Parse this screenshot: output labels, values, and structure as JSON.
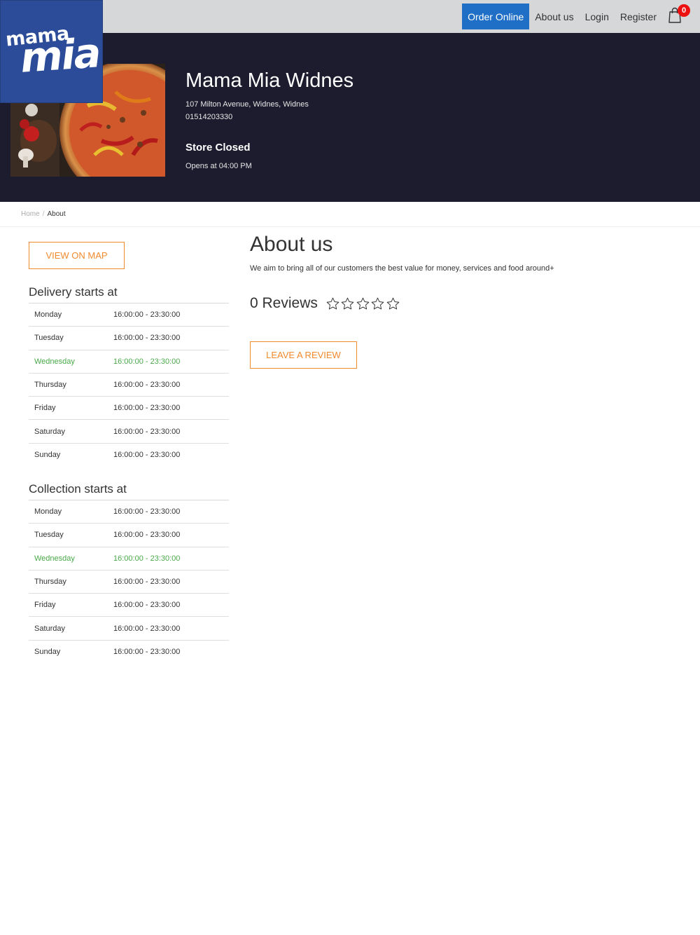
{
  "nav": {
    "order_online": "Order Online",
    "about": "About us",
    "login": "Login",
    "register": "Register",
    "cart_count": "0"
  },
  "logo": {
    "line1": "mama",
    "line2": "mia"
  },
  "store": {
    "name": "Mama Mia Widnes",
    "address": "107 Milton Avenue, Widnes, Widnes",
    "phone": "01514203330",
    "status": "Store Closed",
    "opens": "Opens at 04:00 PM"
  },
  "breadcrumb": {
    "home": "Home",
    "separator": "/",
    "current": "About"
  },
  "map_button": "VIEW ON MAP",
  "delivery": {
    "title": "Delivery starts at",
    "rows": [
      {
        "day": "Monday",
        "time": "16:00:00 - 23:30:00"
      },
      {
        "day": "Tuesday",
        "time": "16:00:00 - 23:30:00"
      },
      {
        "day": "Wednesday",
        "time": "16:00:00 - 23:30:00"
      },
      {
        "day": "Thursday",
        "time": "16:00:00 - 23:30:00"
      },
      {
        "day": "Friday",
        "time": "16:00:00 - 23:30:00"
      },
      {
        "day": "Saturday",
        "time": "16:00:00 - 23:30:00"
      },
      {
        "day": "Sunday",
        "time": "16:00:00 - 23:30:00"
      }
    ]
  },
  "collection": {
    "title": "Collection starts at",
    "rows": [
      {
        "day": "Monday",
        "time": "16:00:00 - 23:30:00"
      },
      {
        "day": "Tuesday",
        "time": "16:00:00 - 23:30:00"
      },
      {
        "day": "Wednesday",
        "time": "16:00:00 - 23:30:00"
      },
      {
        "day": "Thursday",
        "time": "16:00:00 - 23:30:00"
      },
      {
        "day": "Friday",
        "time": "16:00:00 - 23:30:00"
      },
      {
        "day": "Saturday",
        "time": "16:00:00 - 23:30:00"
      },
      {
        "day": "Sunday",
        "time": "16:00:00 - 23:30:00"
      }
    ]
  },
  "about": {
    "title": "About us",
    "text": "We aim to bring all of our customers the best value for money, services and food around+",
    "reviews": "0 Reviews",
    "rating": 0,
    "rating_max": 5,
    "leave_review": "LEAVE A REVIEW"
  },
  "colors": {
    "accent_orange": "#f08a2c",
    "order_blue": "#1f6fc6",
    "hero_bg": "#1c1c2e",
    "logo_blue": "#2c4c99",
    "today_green": "#4aa84a",
    "badge_red": "#ee1111"
  }
}
